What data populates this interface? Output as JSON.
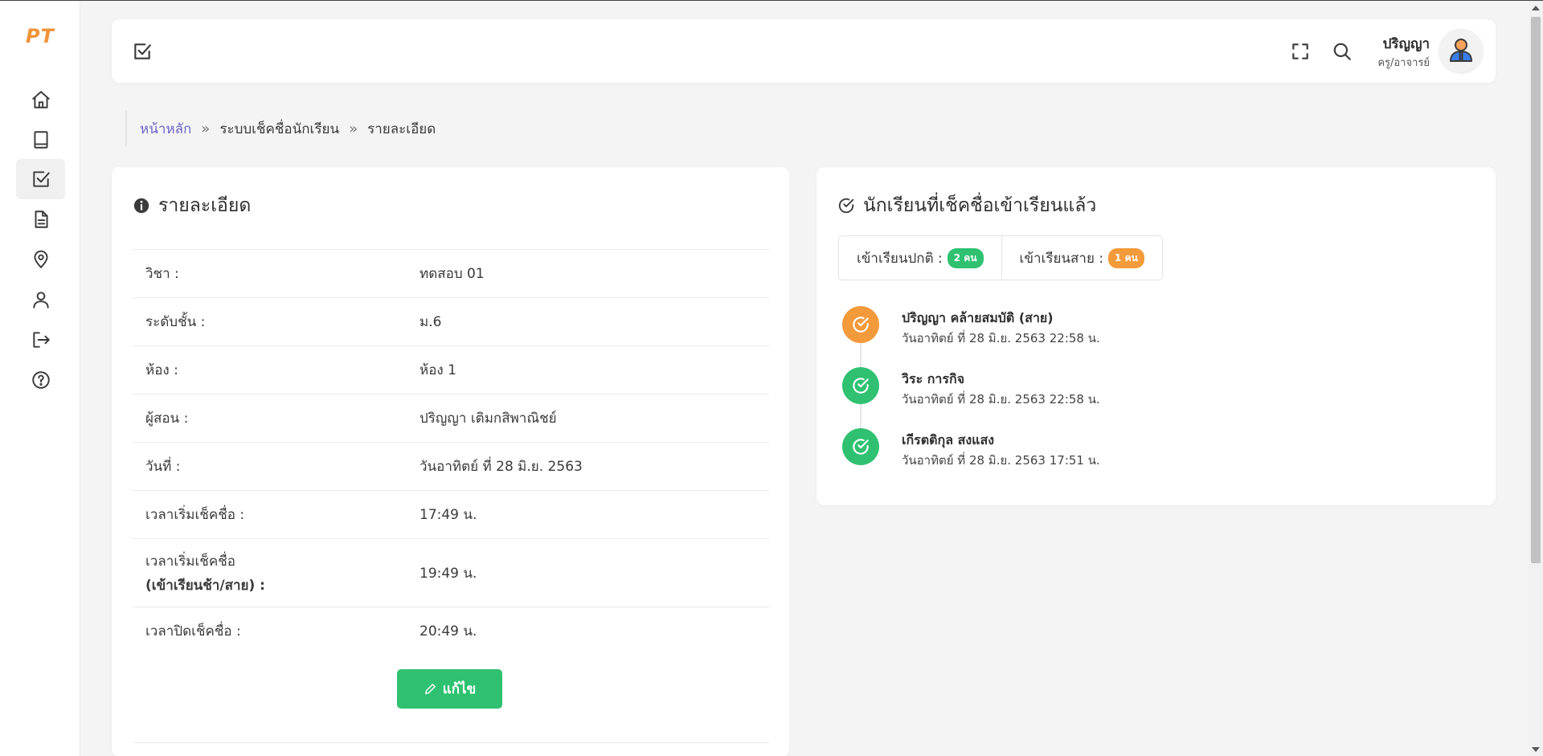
{
  "app": {
    "logo": "PT"
  },
  "sidebar": {
    "items": [
      {
        "name": "home-icon"
      },
      {
        "name": "book-icon"
      },
      {
        "name": "checklist-icon",
        "active": true
      },
      {
        "name": "document-icon"
      },
      {
        "name": "location-icon"
      },
      {
        "name": "user-icon"
      },
      {
        "name": "logout-icon"
      },
      {
        "name": "help-icon"
      }
    ]
  },
  "header": {
    "user_name": "ปริญญา",
    "user_role": "ครู/อาจารย์"
  },
  "breadcrumb": {
    "home": "หน้าหลัก",
    "level1": "ระบบเช็คชื่อนักเรียน",
    "level2": "รายละเอียด",
    "separator": "»"
  },
  "details": {
    "title": "รายละเอียด",
    "rows": [
      {
        "label": "วิชา :",
        "value": "ทดสอบ 01"
      },
      {
        "label": "ระดับชั้น :",
        "value": "ม.6"
      },
      {
        "label": "ห้อง :",
        "value": "ห้อง 1"
      },
      {
        "label": "ผู้สอน :",
        "value": "ปริญญา เติมกสิพาณิชย์"
      },
      {
        "label": "วันที่ :",
        "value": "วันอาทิตย์ ที่ 28 มิ.ย. 2563"
      },
      {
        "label": "เวลาเริ่มเช็คชื่อ :",
        "value": "17:49 น."
      },
      {
        "label": "เวลาเริ่มเช็คชื่อ",
        "label_extra": "(เข้าเรียนช้า/สาย) :",
        "value": "19:49 น."
      },
      {
        "label": "เวลาปิดเช็คชื่อ :",
        "value": "20:49 น."
      }
    ],
    "edit_label": "แก้ไข"
  },
  "attendance": {
    "title": "นักเรียนที่เช็คชื่อเข้าเรียนแล้ว",
    "normal_label": "เข้าเรียนปกติ :",
    "normal_count": "2 คน",
    "late_label": "เข้าเรียนสาย :",
    "late_count": "1 คน",
    "students": [
      {
        "name": "ปริญญา คล้ายสมบัติ (สาย)",
        "time": "วันอาทิตย์ ที่ 28 มิ.ย. 2563 22:58 น.",
        "status": "late"
      },
      {
        "name": "วิระ การกิจ",
        "time": "วันอาทิตย์ ที่ 28 มิ.ย. 2563 22:58 น.",
        "status": "normal"
      },
      {
        "name": "เกีรตติกุล สงแสง",
        "time": "วันอาทิตย์ ที่ 28 มิ.ย. 2563 17:51 น.",
        "status": "normal"
      }
    ]
  },
  "colors": {
    "accent_green": "#2fc171",
    "accent_orange": "#f39a3a",
    "link_purple": "#6c63c9",
    "logo_orange": "#f0933a"
  }
}
